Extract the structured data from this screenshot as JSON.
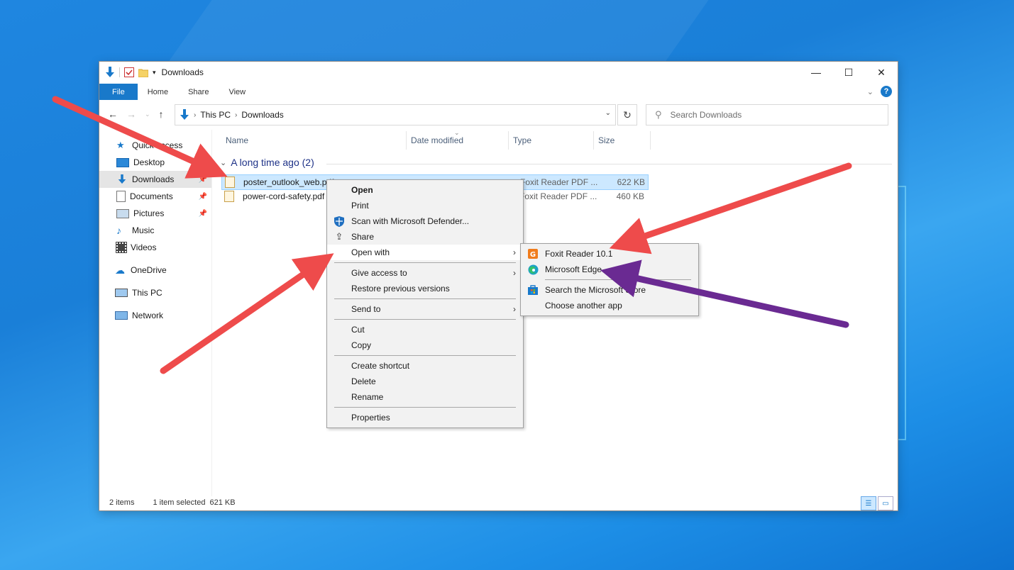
{
  "window": {
    "title": "Downloads",
    "controls": {
      "minimize": "—",
      "maximize": "☐",
      "close": "✕"
    }
  },
  "ribbon": {
    "tabs": [
      "File",
      "Home",
      "Share",
      "View"
    ],
    "help": "?"
  },
  "address": {
    "crumbs": [
      "This PC",
      "Downloads"
    ],
    "search_placeholder": "Search Downloads"
  },
  "sidebar": {
    "items": [
      {
        "label": "Quick access",
        "icon": "star-icon"
      },
      {
        "label": "Desktop",
        "icon": "desktop-icon"
      },
      {
        "label": "Downloads",
        "icon": "download-icon",
        "selected": true
      },
      {
        "label": "Documents",
        "icon": "documents-icon"
      },
      {
        "label": "Pictures",
        "icon": "pictures-icon"
      },
      {
        "label": "Music",
        "icon": "music-icon"
      },
      {
        "label": "Videos",
        "icon": "videos-icon"
      },
      {
        "label": "OneDrive",
        "icon": "cloud-icon"
      },
      {
        "label": "This PC",
        "icon": "computer-icon"
      },
      {
        "label": "Network",
        "icon": "network-icon"
      }
    ]
  },
  "columns": [
    "Name",
    "Date modified",
    "Type",
    "Size"
  ],
  "group": {
    "label": "A long time ago (2)"
  },
  "files": [
    {
      "name": "poster_outlook_web.pdf",
      "type": "Foxit Reader PDF ...",
      "size": "622 KB",
      "selected": true
    },
    {
      "name": "power-cord-safety.pdf",
      "type": "Foxit Reader PDF ...",
      "size": "460 KB"
    }
  ],
  "status": {
    "count": "2 items",
    "selection": "1 item selected",
    "sel_size": "621 KB"
  },
  "context_menu": {
    "open": "Open",
    "print": "Print",
    "scan": "Scan with Microsoft Defender...",
    "share": "Share",
    "open_with": "Open with",
    "give_access": "Give access to",
    "restore": "Restore previous versions",
    "send_to": "Send to",
    "cut": "Cut",
    "copy": "Copy",
    "create_shortcut": "Create shortcut",
    "delete": "Delete",
    "rename": "Rename",
    "properties": "Properties"
  },
  "open_with_menu": {
    "foxit": "Foxit Reader 10.1",
    "edge": "Microsoft Edge",
    "store": "Search the Microsoft Store",
    "choose": "Choose another app"
  },
  "colors": {
    "accent": "#1979ca",
    "arrow_red": "#ee4b4b",
    "arrow_purple": "#6a2a92",
    "desktop_blue": "#1a7fd8"
  }
}
